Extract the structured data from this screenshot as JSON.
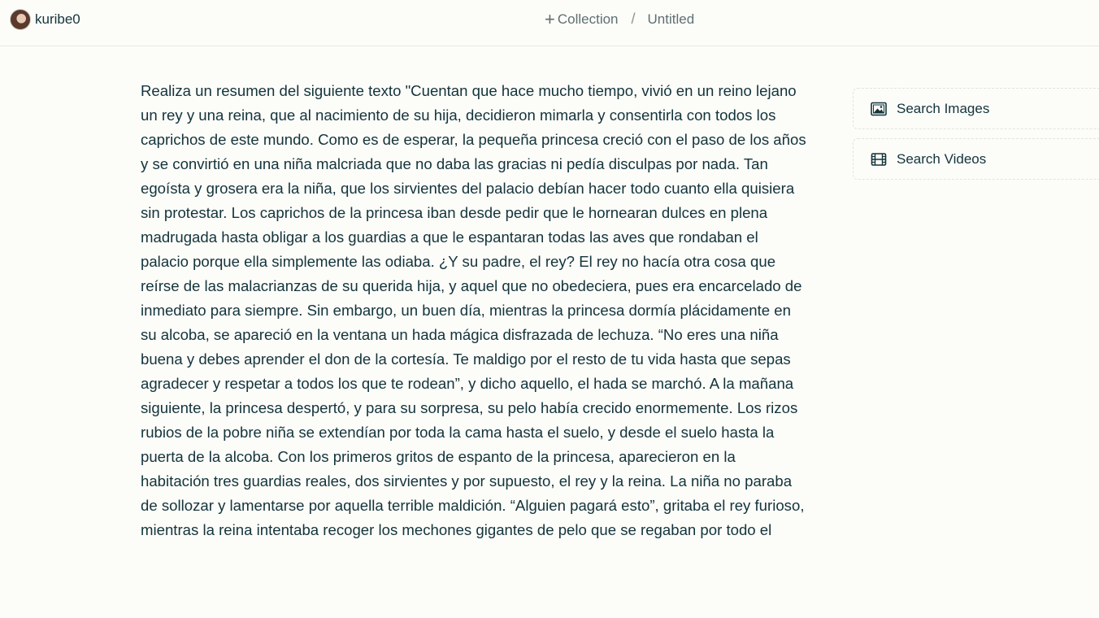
{
  "header": {
    "username": "kuribe0",
    "collection_label": "Collection",
    "separator": "/",
    "thread_title": "Untitled"
  },
  "query": {
    "text": "Realiza un resumen del siguiente texto \"Cuentan que hace mucho tiempo, vivió en un reino lejano un rey y una reina, que al nacimiento de su hija, decidieron mimarla y consentirla con todos los caprichos de este mundo. Como es de esperar, la pequeña princesa creció con el paso de los años y se convirtió en una niña malcriada que no daba las gracias ni pedía disculpas por nada. Tan egoísta y grosera era la niña, que los sirvientes del palacio debían hacer todo cuanto ella quisiera sin protestar. Los caprichos de la princesa iban desde pedir que le hornearan dulces en plena madrugada hasta obligar a los guardias a que le espantaran todas las aves que rondaban el palacio porque ella simplemente las odiaba. ¿Y su padre, el rey? El rey no hacía otra cosa que reírse de las malacrianzas de su querida hija, y aquel que no obedeciera, pues era encarcelado de inmediato para siempre. Sin embargo, un buen día, mientras la princesa dormía plácidamente en su alcoba, se apareció en la ventana un hada mágica disfrazada de lechuza. “No eres una niña buena y debes aprender el don de la cortesía. Te maldigo por el resto de tu vida hasta que sepas agradecer y respetar a todos los que te rodean”, y dicho aquello, el hada se marchó. A la mañana siguiente, la princesa despertó, y para su sorpresa, su pelo había crecido enormemente. Los rizos rubios de la pobre niña se extendían por toda la cama hasta el suelo, y desde el suelo hasta la puerta de la alcoba. Con los primeros gritos de espanto de la princesa, aparecieron en la habitación tres guardias reales, dos sirvientes y por supuesto, el rey y la reina. La niña no paraba de sollozar y lamentarse por aquella terrible maldición. “Alguien pagará esto”, gritaba el rey furioso, mientras la reina intentaba recoger los mechones gigantes de pelo que se regaban por todo el"
  },
  "sidebar": {
    "search_images": {
      "label": "Search Images",
      "icon": "image-icon"
    },
    "search_videos": {
      "label": "Search Videos",
      "icon": "film-icon"
    }
  }
}
